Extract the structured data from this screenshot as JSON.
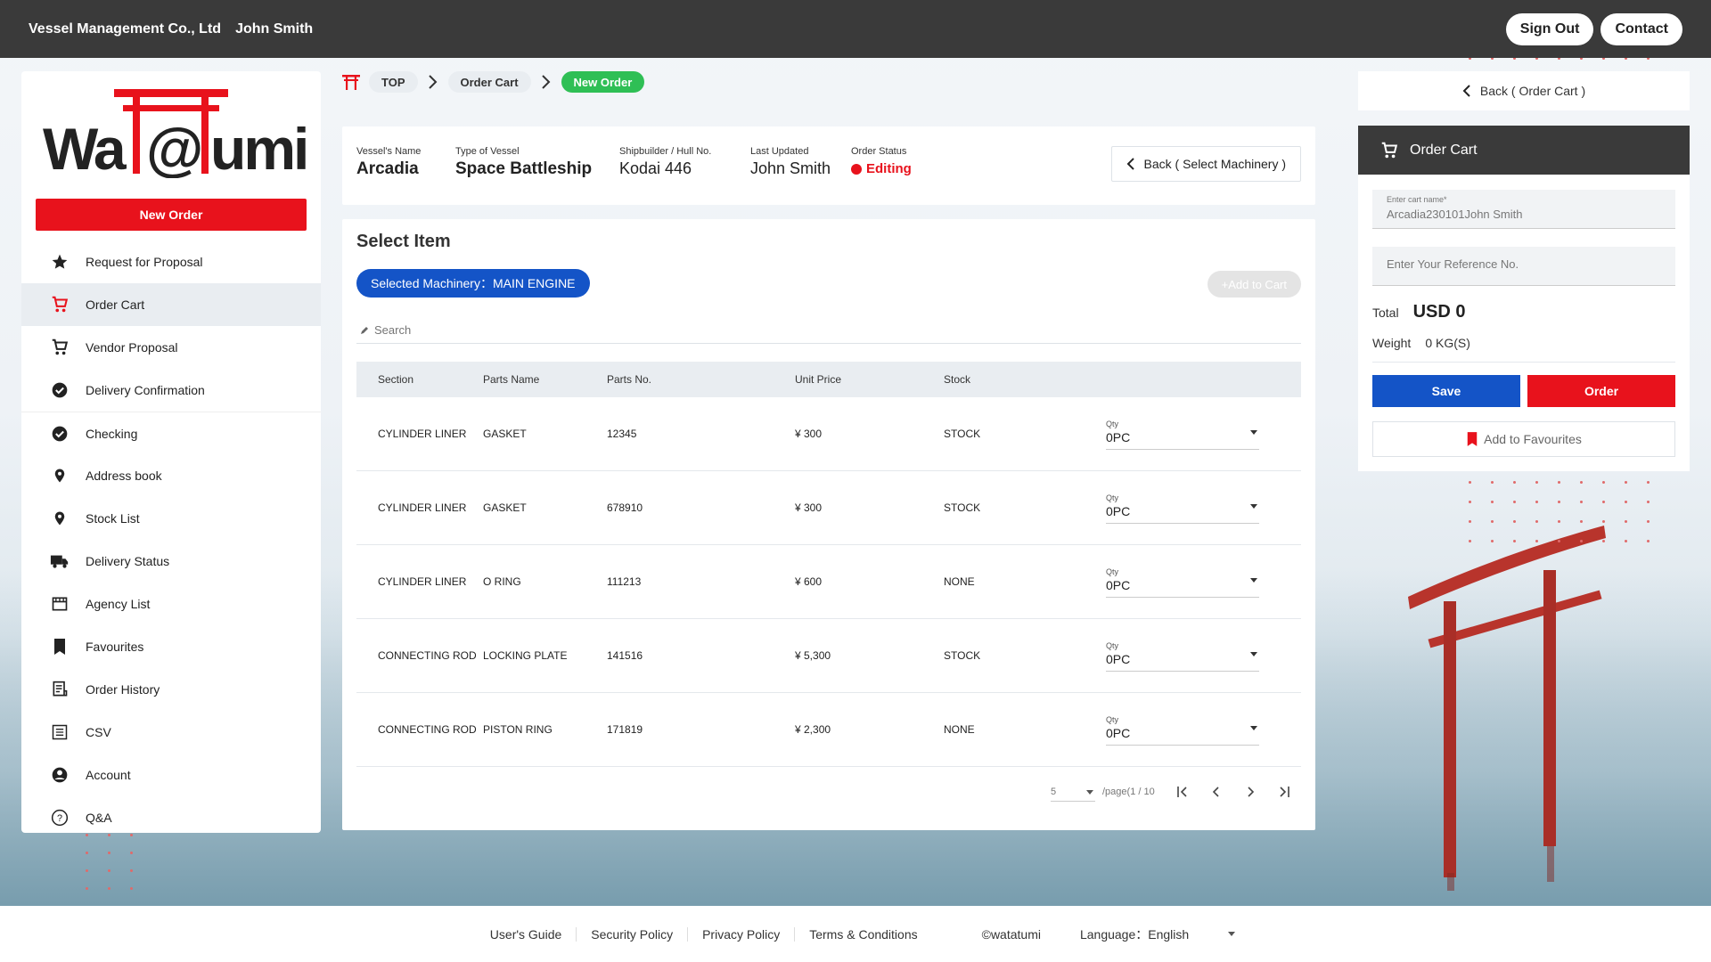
{
  "header": {
    "company": "Vessel Management Co., Ltd",
    "user": "John Smith",
    "sign_out": "Sign Out",
    "contact": "Contact"
  },
  "sidebar": {
    "logo_text": "Wa@umi",
    "new_order": "New Order",
    "items": [
      {
        "label": "Request for Proposal",
        "icon": "star-icon"
      },
      {
        "label": "Order Cart",
        "icon": "cart-icon",
        "active": true
      },
      {
        "label": "Vendor Proposal",
        "icon": "cart-icon"
      },
      {
        "label": "Delivery Confirmation",
        "icon": "check-circle-icon"
      },
      {
        "label": "Checking",
        "icon": "check-circle-icon"
      },
      {
        "label": "Address book",
        "icon": "location-pin-icon"
      },
      {
        "label": "Stock List",
        "icon": "location-pin-icon"
      },
      {
        "label": "Delivery Status",
        "icon": "truck-icon"
      },
      {
        "label": "Agency List",
        "icon": "store-icon"
      },
      {
        "label": "Favourites",
        "icon": "bookmark-icon"
      },
      {
        "label": "Order History",
        "icon": "receipt-icon"
      },
      {
        "label": "CSV",
        "icon": "list-icon"
      },
      {
        "label": "Account",
        "icon": "account-circle-icon"
      },
      {
        "label": "Q&A",
        "icon": "help-circle-icon"
      }
    ]
  },
  "breadcrumb": {
    "top": "TOP",
    "order_cart": "Order Cart",
    "current": "New Order"
  },
  "vessel": {
    "name_label": "Vessel's Name",
    "name": "Arcadia",
    "type_label": "Type of Vessel",
    "type": "Space Battleship",
    "builder_label": "Shipbuilder / Hull No.",
    "builder": "Kodai 446",
    "updated_label": "Last Updated",
    "updated": "John Smith",
    "status_label": "Order Status",
    "status": "Editing",
    "back_label": "Back ( Select Machinery )"
  },
  "items": {
    "title": "Select Item",
    "machinery": "Selected Machinery：MAIN ENGINE",
    "add_to_cart": "+Add to Cart",
    "search_placeholder": "Search",
    "columns": [
      "Section",
      "Parts Name",
      "Parts No.",
      "Unit Price",
      "Stock"
    ],
    "rows": [
      {
        "section": "CYLINDER LINER",
        "parts_name": "GASKET",
        "parts_no": "12345",
        "price": "¥ 300",
        "stock": "STOCK",
        "qty_label": "Qty",
        "qty": "0PC"
      },
      {
        "section": "CYLINDER LINER",
        "parts_name": "GASKET",
        "parts_no": "678910",
        "price": "¥ 300",
        "stock": "STOCK",
        "qty_label": "Qty",
        "qty": "0PC"
      },
      {
        "section": "CYLINDER LINER",
        "parts_name": "O RING",
        "parts_no": "111213",
        "price": "¥ 600",
        "stock": "NONE",
        "qty_label": "Qty",
        "qty": "0PC"
      },
      {
        "section": "CONNECTING ROD",
        "parts_name": "LOCKING PLATE",
        "parts_no": "141516",
        "price": "¥ 5,300",
        "stock": "STOCK",
        "qty_label": "Qty",
        "qty": "0PC"
      },
      {
        "section": "CONNECTING ROD",
        "parts_name": "PISTON RING",
        "parts_no": "171819",
        "price": "¥ 2,300",
        "stock": "NONE",
        "qty_label": "Qty",
        "qty": "0PC"
      }
    ],
    "pager": {
      "per_page": "5",
      "page_text": "/page(1 / 10"
    }
  },
  "cart": {
    "back_label": "Back ( Order Cart )",
    "title": "Order Cart",
    "name_label": "Enter cart name*",
    "name_value": "Arcadia230101John Smith",
    "ref_placeholder": "Enter Your Reference No.",
    "total_label": "Total",
    "total_value": "USD 0",
    "weight_label": "Weight",
    "weight_value": "0 KG(S)",
    "save": "Save",
    "order": "Order",
    "favourites": "Add to Favourites"
  },
  "footer": {
    "links": [
      "User's Guide",
      "Security Policy",
      "Privacy Policy",
      "Terms & Conditions"
    ],
    "copyright": "©watatumi",
    "language": "Language：English"
  },
  "colors": {
    "brand_red": "#e8121c",
    "primary_blue": "#1454c7",
    "success_green": "#2fbf55",
    "header_dark": "#3a3a3a"
  }
}
